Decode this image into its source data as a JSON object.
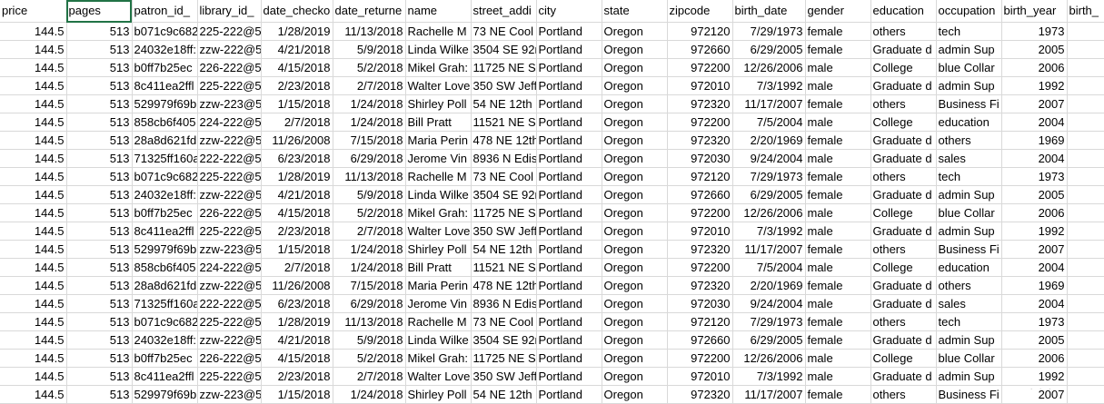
{
  "columns": [
    {
      "key": "price",
      "label": "price",
      "align": "right"
    },
    {
      "key": "pages",
      "label": "pages",
      "align": "right"
    },
    {
      "key": "patron_id",
      "label": "patron_id_",
      "align": "left"
    },
    {
      "key": "library_id",
      "label": "library_id_",
      "align": "left"
    },
    {
      "key": "date_checkout",
      "label": "date_checko",
      "align": "right"
    },
    {
      "key": "date_returned",
      "label": "date_returne",
      "align": "right"
    },
    {
      "key": "name",
      "label": "name",
      "align": "left"
    },
    {
      "key": "street_address",
      "label": "street_addi",
      "align": "left"
    },
    {
      "key": "city",
      "label": "city",
      "align": "left"
    },
    {
      "key": "state",
      "label": "state",
      "align": "left"
    },
    {
      "key": "zipcode",
      "label": "zipcode",
      "align": "right"
    },
    {
      "key": "birth_date",
      "label": "birth_date",
      "align": "right"
    },
    {
      "key": "gender",
      "label": "gender",
      "align": "left"
    },
    {
      "key": "education",
      "label": "education",
      "align": "left"
    },
    {
      "key": "occupation",
      "label": "occupation",
      "align": "left"
    },
    {
      "key": "birth_year",
      "label": "birth_year",
      "align": "right"
    },
    {
      "key": "birth_extra",
      "label": "birth_",
      "align": "left"
    }
  ],
  "rows": [
    [
      "144.5",
      "513",
      "b071c9c682",
      "225-222@5:",
      "1/28/2019",
      "11/13/2018",
      "Rachelle M",
      "73   NE Cool",
      "Portland",
      "Oregon",
      "972120",
      "7/29/1973",
      "female",
      "others",
      "tech",
      "1973",
      ""
    ],
    [
      "144.5",
      "513",
      "24032e18ff:",
      "zzw-222@5",
      "4/21/2018",
      "5/9/2018",
      "Linda Wilke",
      "3504 SE 92n",
      "Portland",
      "Oregon",
      "972660",
      "6/29/2005",
      "female",
      "Graduate d",
      "admin  Sup",
      "2005",
      ""
    ],
    [
      "144.5",
      "513",
      "b0ff7b25ec",
      "226-222@5:",
      "4/15/2018",
      "5/2/2018",
      "Mikel Grah:",
      "11725 NE Sa",
      "Portland",
      "Oregon",
      "972200",
      "12/26/2006",
      "male",
      "College",
      "blue Collar",
      "2006",
      ""
    ],
    [
      "144.5",
      "513",
      "8c411ea2ffl",
      "225-222@5:",
      "2/23/2018",
      "2/7/2018",
      "Walter Love",
      "350 SW Jeff",
      "Portland",
      "Oregon",
      "972010",
      "7/3/1992",
      "male",
      "Graduate d",
      "admin  Sup",
      "1992",
      ""
    ],
    [
      "144.5",
      "513",
      "529979f69b",
      "zzw-223@5",
      "1/15/2018",
      "1/24/2018",
      "Shirley Poll",
      "54 NE 12th ,",
      "Portland",
      "Oregon",
      "972320",
      "11/17/2007",
      "female",
      "others",
      "Business  Fi",
      "2007",
      ""
    ],
    [
      "144.5",
      "513",
      "858cb6f405",
      "224-222@5:",
      "2/7/2018",
      "1/24/2018",
      "Bill Pratt",
      "11521 NE Sa",
      "Portland",
      "Oregon",
      "972200",
      "7/5/2004",
      "male",
      "College",
      "education",
      "2004",
      ""
    ],
    [
      "144.5",
      "513",
      "28a8d621fd",
      "zzw-222@5",
      "11/26/2008",
      "7/15/2018",
      "Maria Perin",
      "478 NE 12th",
      "Portland",
      "Oregon",
      "972320",
      "2/20/1969",
      "female",
      "Graduate d",
      "others",
      "1969",
      ""
    ],
    [
      "144.5",
      "513",
      "71325ff160a",
      "222-222@5:",
      "6/23/2018",
      "6/29/2018",
      "Jerome Vin",
      "8936 N Edis",
      "Portland",
      "Oregon",
      "972030",
      "9/24/2004",
      "male",
      "Graduate d",
      "sales",
      "2004",
      ""
    ],
    [
      "144.5",
      "513",
      "b071c9c682",
      "225-222@5:",
      "1/28/2019",
      "11/13/2018",
      "Rachelle M",
      "73   NE Cool",
      "Portland",
      "Oregon",
      "972120",
      "7/29/1973",
      "female",
      "others",
      "tech",
      "1973",
      ""
    ],
    [
      "144.5",
      "513",
      "24032e18ff:",
      "zzw-222@5",
      "4/21/2018",
      "5/9/2018",
      "Linda Wilke",
      "3504 SE 92n",
      "Portland",
      "Oregon",
      "972660",
      "6/29/2005",
      "female",
      "Graduate d",
      "admin  Sup",
      "2005",
      ""
    ],
    [
      "144.5",
      "513",
      "b0ff7b25ec",
      "226-222@5:",
      "4/15/2018",
      "5/2/2018",
      "Mikel Grah:",
      "11725 NE Sa",
      "Portland",
      "Oregon",
      "972200",
      "12/26/2006",
      "male",
      "College",
      "blue Collar",
      "2006",
      ""
    ],
    [
      "144.5",
      "513",
      "8c411ea2ffl",
      "225-222@5:",
      "2/23/2018",
      "2/7/2018",
      "Walter Love",
      "350 SW Jeff",
      "Portland",
      "Oregon",
      "972010",
      "7/3/1992",
      "male",
      "Graduate d",
      "admin  Sup",
      "1992",
      ""
    ],
    [
      "144.5",
      "513",
      "529979f69b",
      "zzw-223@5",
      "1/15/2018",
      "1/24/2018",
      "Shirley Poll",
      "54 NE 12th ,",
      "Portland",
      "Oregon",
      "972320",
      "11/17/2007",
      "female",
      "others",
      "Business  Fi",
      "2007",
      ""
    ],
    [
      "144.5",
      "513",
      "858cb6f405",
      "224-222@5:",
      "2/7/2018",
      "1/24/2018",
      "Bill Pratt",
      "11521 NE Sa",
      "Portland",
      "Oregon",
      "972200",
      "7/5/2004",
      "male",
      "College",
      "education",
      "2004",
      ""
    ],
    [
      "144.5",
      "513",
      "28a8d621fd",
      "zzw-222@5",
      "11/26/2008",
      "7/15/2018",
      "Maria Perin",
      "478 NE 12th",
      "Portland",
      "Oregon",
      "972320",
      "2/20/1969",
      "female",
      "Graduate d",
      "others",
      "1969",
      ""
    ],
    [
      "144.5",
      "513",
      "71325ff160a",
      "222-222@5:",
      "6/23/2018",
      "6/29/2018",
      "Jerome Vin",
      "8936 N Edis",
      "Portland",
      "Oregon",
      "972030",
      "9/24/2004",
      "male",
      "Graduate d",
      "sales",
      "2004",
      ""
    ],
    [
      "144.5",
      "513",
      "b071c9c682",
      "225-222@5:",
      "1/28/2019",
      "11/13/2018",
      "Rachelle M",
      "73   NE Cool",
      "Portland",
      "Oregon",
      "972120",
      "7/29/1973",
      "female",
      "others",
      "tech",
      "1973",
      ""
    ],
    [
      "144.5",
      "513",
      "24032e18ff:",
      "zzw-222@5",
      "4/21/2018",
      "5/9/2018",
      "Linda Wilke",
      "3504 SE 92n",
      "Portland",
      "Oregon",
      "972660",
      "6/29/2005",
      "female",
      "Graduate d",
      "admin  Sup",
      "2005",
      ""
    ],
    [
      "144.5",
      "513",
      "b0ff7b25ec",
      "226-222@5:",
      "4/15/2018",
      "5/2/2018",
      "Mikel Grah:",
      "11725 NE Sa",
      "Portland",
      "Oregon",
      "972200",
      "12/26/2006",
      "male",
      "College",
      "blue Collar",
      "2006",
      ""
    ],
    [
      "144.5",
      "513",
      "8c411ea2ffl",
      "225-222@5:",
      "2/23/2018",
      "2/7/2018",
      "Walter Love",
      "350 SW Jeff",
      "Portland",
      "Oregon",
      "972010",
      "7/3/1992",
      "male",
      "Graduate d",
      "admin  Sup",
      "1992",
      ""
    ],
    [
      "144.5",
      "513",
      "529979f69b",
      "zzw-223@5",
      "1/15/2018",
      "1/24/2018",
      "Shirley Poll",
      "54 NE 12th ,",
      "Portland",
      "Oregon",
      "972320",
      "11/17/2007",
      "female",
      "others",
      "Business  Fi",
      "2007",
      ""
    ]
  ],
  "colors": {
    "gridline": "#d9d9d9",
    "selection": "#217346"
  }
}
